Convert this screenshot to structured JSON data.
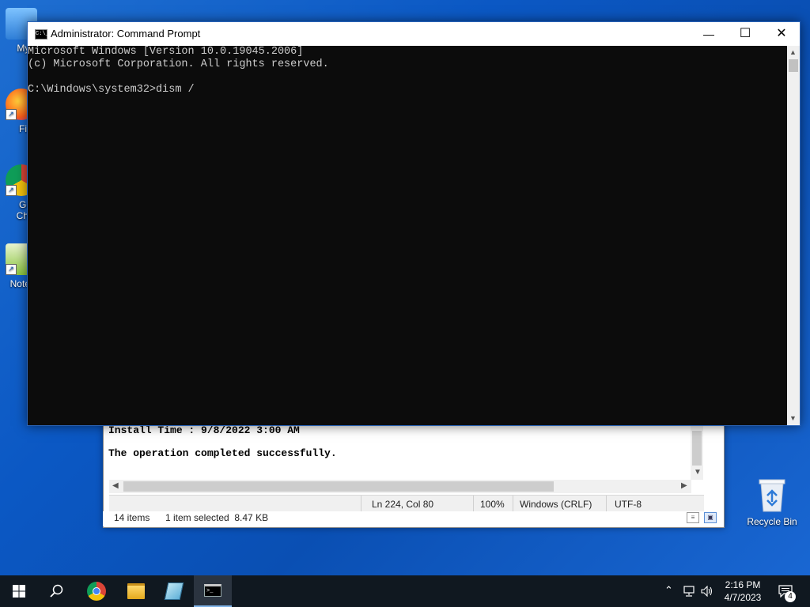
{
  "desktop": {
    "icons": [
      {
        "label": "My Co",
        "icon": "computer-icon"
      },
      {
        "label": "Fir",
        "icon": "firefox-icon"
      },
      {
        "label": "Go Chr",
        "icon": "chrome-icon"
      },
      {
        "label": "Note",
        "icon": "notepad-plus-icon"
      }
    ],
    "recycle_bin_label": "Recycle Bin"
  },
  "cmd": {
    "title": "Administrator: Command Prompt",
    "icon_text": "C:\\_",
    "lines": [
      "Microsoft Windows [Version 10.0.19045.2006]",
      "(c) Microsoft Corporation. All rights reserved.",
      "",
      "C:\\Windows\\system32>dism /"
    ],
    "controls": {
      "minimize": "—",
      "maximize": "☐",
      "close": "✕"
    }
  },
  "notepad": {
    "text_lines": [
      "Install Time : 9/8/2022 3:00 AM",
      "",
      "The operation completed successfully."
    ],
    "status": {
      "position": "Ln 224, Col 80",
      "zoom": "100%",
      "line_ending": "Windows (CRLF)",
      "encoding": "UTF-8"
    }
  },
  "explorer_status": {
    "items": "14 items",
    "selected": "1 item selected  8.47 KB"
  },
  "taskbar": {
    "items": [
      "start-icon",
      "search-icon",
      "chrome-icon",
      "file-explorer-icon",
      "notepad-icon",
      "cmd-icon"
    ],
    "clock_time": "2:16 PM",
    "clock_date": "4/7/2023",
    "notification_count": "4"
  }
}
